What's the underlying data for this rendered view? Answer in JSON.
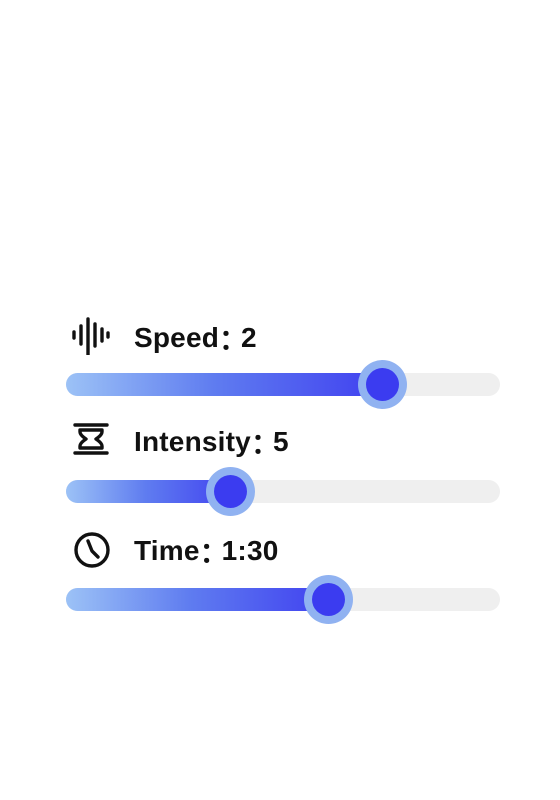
{
  "controls": [
    {
      "id": "speed",
      "icon": "audio-waveform-icon",
      "label": "Speed",
      "separator": "：",
      "value": "2",
      "fraction": 0.73
    },
    {
      "id": "intensity",
      "icon": "hourglass-icon",
      "label": "Intensity",
      "separator": "：",
      "value": "5",
      "fraction": 0.38
    },
    {
      "id": "time",
      "icon": "clock-icon",
      "label": "Time",
      "separator": "：",
      "value": "1:30",
      "fraction": 0.605
    }
  ],
  "colors": {
    "track": "#efefef",
    "fill_start": "#9cc2f6",
    "fill_end": "#3e3cf0",
    "thumb_ring": "#90b2f1",
    "thumb_core": "#3b3cf0"
  }
}
